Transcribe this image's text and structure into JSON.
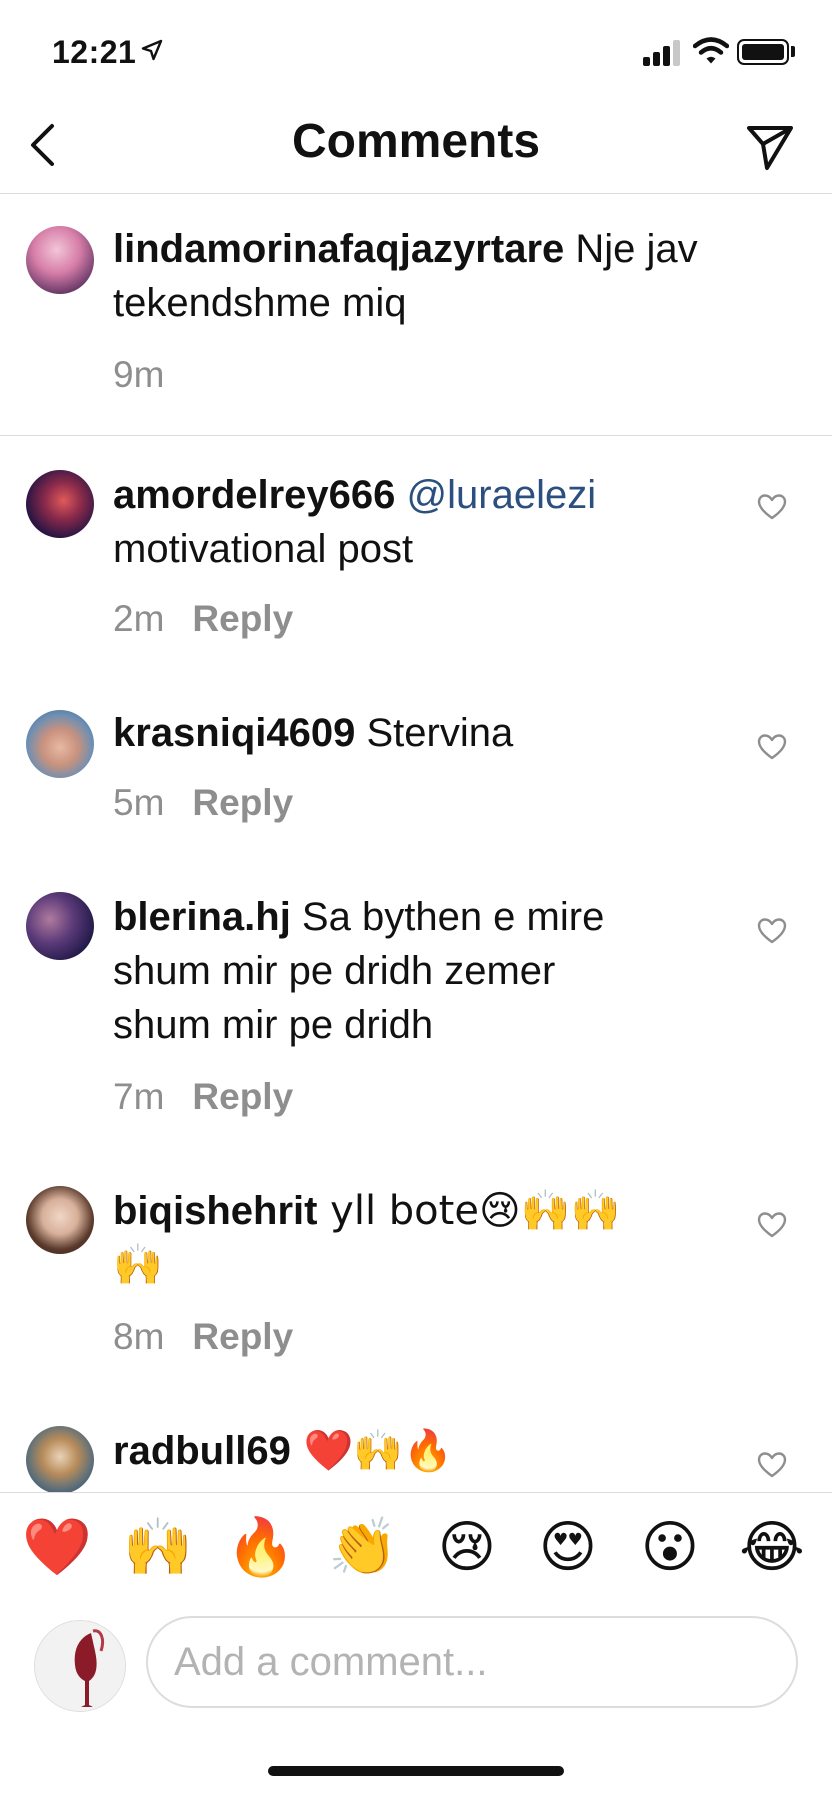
{
  "status_bar": {
    "time": "12:21"
  },
  "header": {
    "title": "Comments",
    "back_icon": "chevron-left-icon",
    "send_icon": "paper-plane-icon"
  },
  "caption": {
    "username": "lindamorinafaqjazyrtare",
    "text": " Nje jav",
    "text_line2": "tekendshme miq",
    "time": "9m"
  },
  "comments": [
    {
      "username": "amordelrey666",
      "mention": "@luraelezi",
      "text_line2": "motivational post",
      "time": "2m",
      "reply": "Reply"
    },
    {
      "username": "krasniqi4609",
      "text": " Stervina",
      "time": "5m",
      "reply": "Reply"
    },
    {
      "username": "blerina.hj",
      "text": " Sa bythen e mire",
      "text_line2": "shum mir pe dridh zemer",
      "text_line3": "shum mir pe dridh",
      "time": "7m",
      "reply": "Reply"
    },
    {
      "username": "biqishehrit",
      "text": " yll bote😢🙌🙌",
      "text_line2": "🙌",
      "time": "8m",
      "reply": "Reply"
    },
    {
      "username": "radbull69",
      "text": " ❤️🙌🔥"
    }
  ],
  "emoji_bar": [
    "❤️",
    "🙌",
    "🔥",
    "👏",
    "😢",
    "😍",
    "😮",
    "😂"
  ],
  "input": {
    "placeholder": "Add a comment..."
  },
  "colors": {
    "mention": "#2b4f7e",
    "meta": "#8e8e8e",
    "divider": "#dcdcdc",
    "heart_emoji": "#e0202e"
  }
}
